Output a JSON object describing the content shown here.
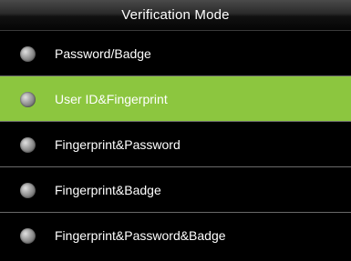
{
  "header": {
    "title": "Verification Mode"
  },
  "colors": {
    "background": "#000000",
    "selected_row": "#8cc63f",
    "divider": "#6a6a6a",
    "text": "#ffffff"
  },
  "options": [
    {
      "label": "Password/Badge",
      "selected": false,
      "icon": "radio-icon"
    },
    {
      "label": "User ID&Fingerprint",
      "selected": true,
      "icon": "radio-icon"
    },
    {
      "label": "Fingerprint&Password",
      "selected": false,
      "icon": "radio-icon"
    },
    {
      "label": "Fingerprint&Badge",
      "selected": false,
      "icon": "radio-icon"
    },
    {
      "label": "Fingerprint&Password&Badge",
      "selected": false,
      "icon": "radio-icon"
    }
  ]
}
